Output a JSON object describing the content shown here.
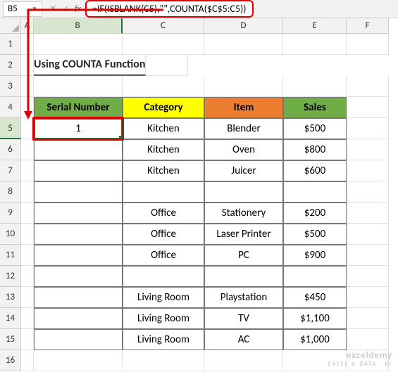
{
  "namebox": "B5",
  "formula": "=IF(ISBLANK(C5),\"\",COUNTA($C$5:C5))",
  "cols": {
    "A": "A",
    "B": "B",
    "C": "C",
    "D": "D",
    "E": "E",
    "F": "F"
  },
  "rows": [
    "1",
    "2",
    "3",
    "4",
    "5",
    "6",
    "7",
    "8",
    "9",
    "10",
    "11",
    "12",
    "13",
    "14",
    "15",
    "16"
  ],
  "title": "Using COUNTA Function",
  "headers": {
    "B": "Serial Number",
    "C": "Category",
    "D": "Item",
    "E": "Sales"
  },
  "table": [
    {
      "serial": "1",
      "category": "Kitchen",
      "item": "Blender",
      "sales": "$500"
    },
    {
      "serial": "",
      "category": "Kitchen",
      "item": "Oven",
      "sales": "$800"
    },
    {
      "serial": "",
      "category": "Kitchen",
      "item": "Juicer",
      "sales": "$600"
    },
    {
      "serial": "",
      "category": "",
      "item": "",
      "sales": ""
    },
    {
      "serial": "",
      "category": "Office",
      "item": "Stationery",
      "sales": "$200"
    },
    {
      "serial": "",
      "category": "Office",
      "item": "Laser Printer",
      "sales": "$500"
    },
    {
      "serial": "",
      "category": "Office",
      "item": "PC",
      "sales": "$900"
    },
    {
      "serial": "",
      "category": "",
      "item": "",
      "sales": ""
    },
    {
      "serial": "",
      "category": "Living Room",
      "item": "Playstation",
      "sales": "$450"
    },
    {
      "serial": "",
      "category": "Living Room",
      "item": "TV",
      "sales": "$1,100"
    },
    {
      "serial": "",
      "category": "Living Room",
      "item": "AC",
      "sales": "$1,000"
    }
  ],
  "watermark": {
    "brand": "exceldemy",
    "tag": "EXCEL & DATA · BI"
  }
}
